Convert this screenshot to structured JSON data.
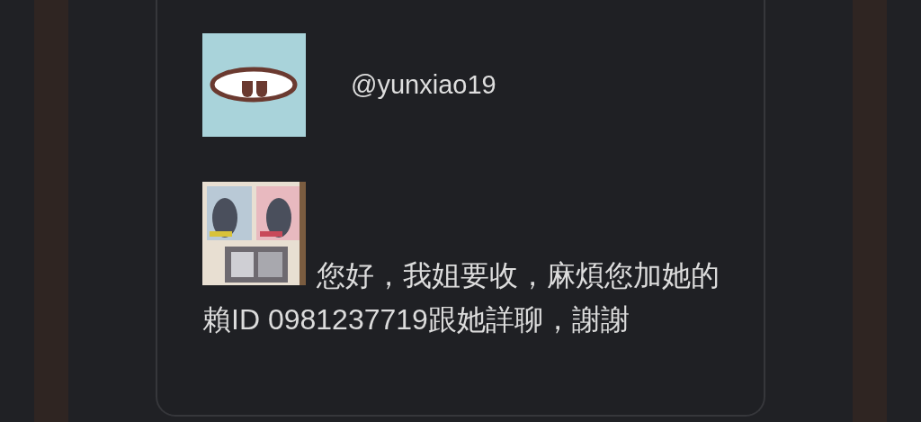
{
  "post": {
    "username": "@yunxiao19",
    "message": "您好，我姐要收，麻煩您加她的賴ID 0981237719跟她詳聊，謝謝"
  }
}
